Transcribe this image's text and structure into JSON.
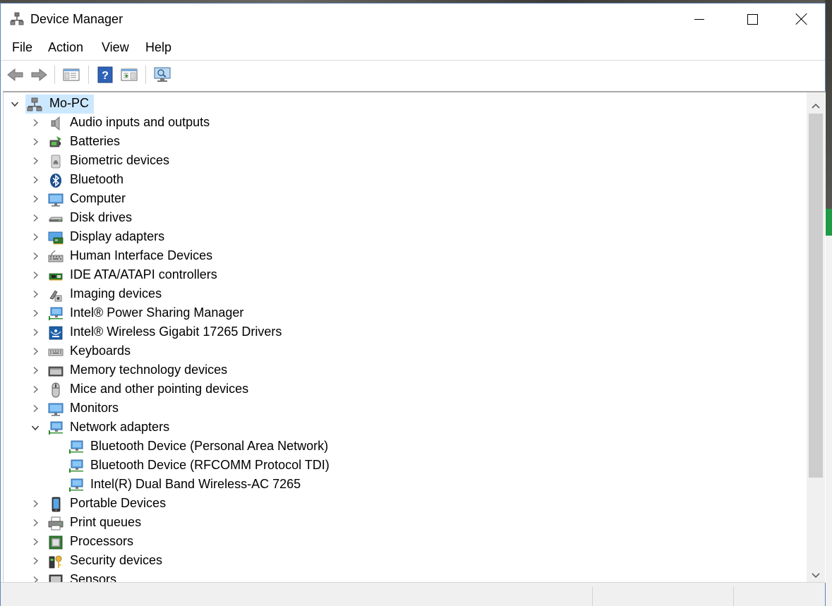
{
  "window": {
    "title": "Device Manager",
    "title_icon": "device-manager-icon"
  },
  "menu": [
    {
      "label": "File"
    },
    {
      "label": "Action"
    },
    {
      "label": "View"
    },
    {
      "label": "Help"
    }
  ],
  "toolbar": [
    {
      "name": "back-button",
      "icon": "arrow-left-icon"
    },
    {
      "name": "forward-button",
      "icon": "arrow-right-icon"
    },
    {
      "name": "show-hide-console-tree-button",
      "icon": "console-tree-icon"
    },
    {
      "name": "help-button",
      "icon": "help-icon"
    },
    {
      "name": "action-pane-button",
      "icon": "action-pane-icon"
    },
    {
      "name": "scan-hardware-button",
      "icon": "monitor-search-icon"
    }
  ],
  "tree": {
    "root": {
      "label": "Mo-PC",
      "expanded": true,
      "icon": "computer-network-icon"
    },
    "items": [
      {
        "label": "Audio inputs and outputs",
        "icon": "speaker-icon",
        "expanded": false
      },
      {
        "label": "Batteries",
        "icon": "battery-icon",
        "expanded": false
      },
      {
        "label": "Biometric devices",
        "icon": "fingerprint-icon",
        "expanded": false
      },
      {
        "label": "Bluetooth",
        "icon": "bluetooth-icon",
        "expanded": false
      },
      {
        "label": "Computer",
        "icon": "monitor-icon",
        "expanded": false
      },
      {
        "label": "Disk drives",
        "icon": "disk-drive-icon",
        "expanded": false
      },
      {
        "label": "Display adapters",
        "icon": "display-adapter-icon",
        "expanded": false
      },
      {
        "label": "Human Interface Devices",
        "icon": "hid-icon",
        "expanded": false
      },
      {
        "label": "IDE ATA/ATAPI controllers",
        "icon": "ide-controller-icon",
        "expanded": false
      },
      {
        "label": "Imaging devices",
        "icon": "camera-icon",
        "expanded": false
      },
      {
        "label": "Intel® Power Sharing Manager",
        "icon": "network-monitor-icon",
        "expanded": false
      },
      {
        "label": "Intel® Wireless Gigabit 17265 Drivers",
        "icon": "wireless-icon",
        "expanded": false
      },
      {
        "label": "Keyboards",
        "icon": "keyboard-icon",
        "expanded": false
      },
      {
        "label": "Memory technology devices",
        "icon": "memory-icon",
        "expanded": false
      },
      {
        "label": "Mice and other pointing devices",
        "icon": "mouse-icon",
        "expanded": false
      },
      {
        "label": "Monitors",
        "icon": "monitor-icon",
        "expanded": false
      },
      {
        "label": "Network adapters",
        "icon": "network-adapter-icon",
        "expanded": true,
        "children": [
          {
            "label": "Bluetooth Device (Personal Area Network)",
            "icon": "network-adapter-icon"
          },
          {
            "label": "Bluetooth Device (RFCOMM Protocol TDI)",
            "icon": "network-adapter-icon"
          },
          {
            "label": "Intel(R) Dual Band Wireless-AC 7265",
            "icon": "network-adapter-icon"
          }
        ]
      },
      {
        "label": "Portable Devices",
        "icon": "portable-device-icon",
        "expanded": false
      },
      {
        "label": "Print queues",
        "icon": "printer-icon",
        "expanded": false
      },
      {
        "label": "Processors",
        "icon": "processor-icon",
        "expanded": false
      },
      {
        "label": "Security devices",
        "icon": "security-key-icon",
        "expanded": false
      },
      {
        "label": "Sensors",
        "icon": "sensor-icon",
        "expanded": false
      }
    ]
  },
  "colors": {
    "selection": "#cce8ff",
    "accent_blue": "#1b6fc4",
    "window_border": "#5d84b8"
  }
}
